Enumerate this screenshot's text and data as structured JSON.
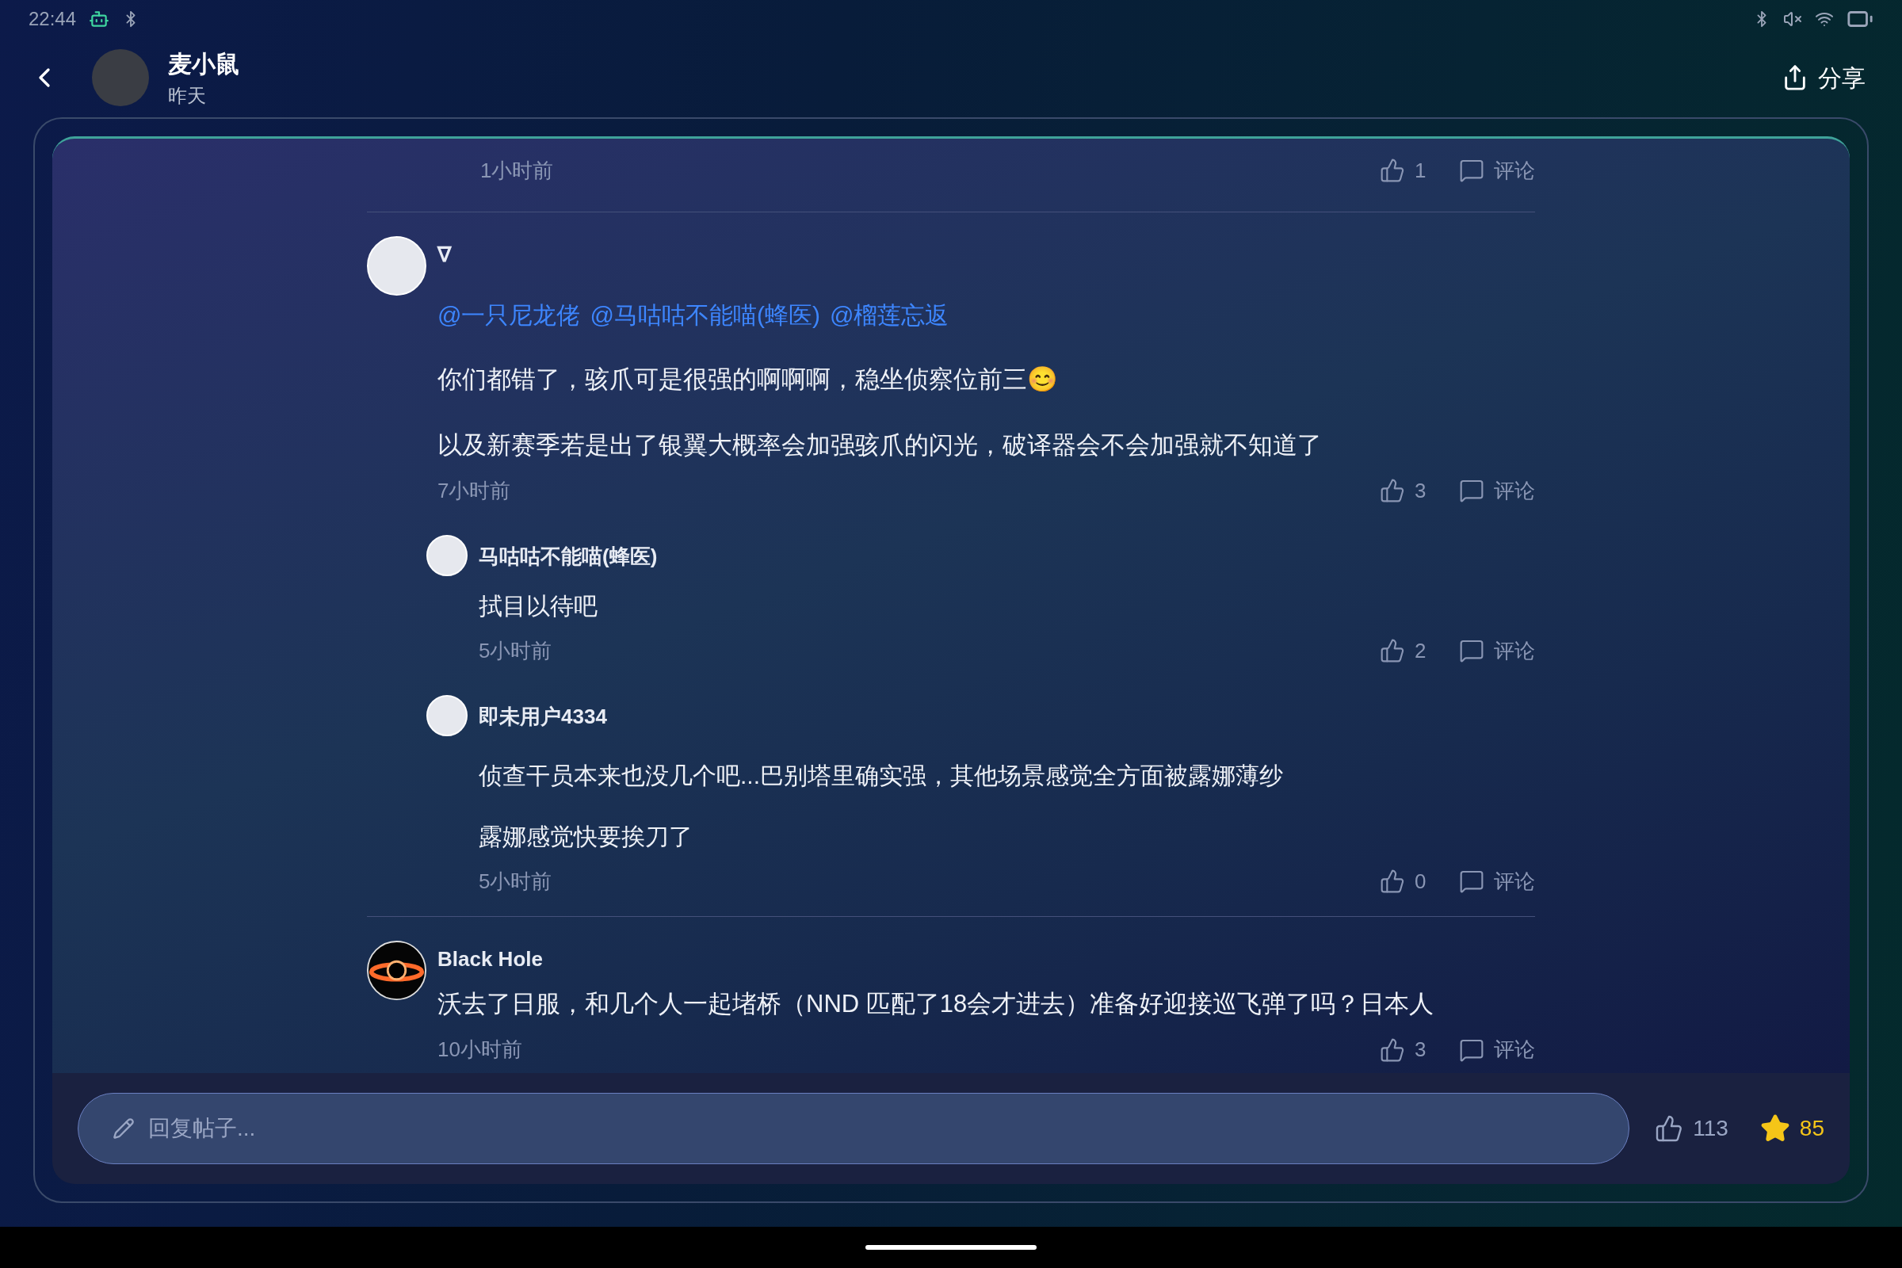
{
  "status_bar": {
    "time": "22:44"
  },
  "header": {
    "title": "麦小鼠",
    "subtitle": "昨天",
    "share": "分享"
  },
  "comments": [
    {
      "kind": "reply_tail",
      "time": "1小时前",
      "likes": "1",
      "reply_label": "评论"
    },
    {
      "kind": "comment",
      "author": "∇",
      "mentions": [
        "@一只尼龙佬",
        "@马咕咕不能喵(蜂医)",
        "@榴莲忘返"
      ],
      "paragraphs": [
        "你们都错了，骇爪可是很强的啊啊啊，稳坐侦察位前三😊",
        "以及新赛季若是出了银翼大概率会加强骇爪的闪光，破译器会不会加强就不知道了"
      ],
      "time": "7小时前",
      "likes": "3",
      "reply_label": "评论",
      "replies": [
        {
          "author": "马咕咕不能喵(蜂医)",
          "paragraphs": [
            "拭目以待吧"
          ],
          "time": "5小时前",
          "likes": "2",
          "reply_label": "评论"
        },
        {
          "author": "即未用户4334",
          "paragraphs": [
            "侦查干员本来也没几个吧...巴别塔里确实强，其他场景感觉全方面被露娜薄纱",
            "露娜感觉快要挨刀了"
          ],
          "time": "5小时前",
          "likes": "0",
          "reply_label": "评论"
        }
      ]
    },
    {
      "kind": "comment",
      "author": "Black Hole",
      "avatar": {
        "kind": "ringed_orb"
      },
      "paragraphs": [
        "沃去了日服，和几个人一起堵桥（NND 匹配了18会才进去）准备好迎接巡飞弹了吗？日本人"
      ],
      "time": "10小时前",
      "likes": "3",
      "reply_label": "评论"
    }
  ],
  "reply_bar": {
    "placeholder": "回复帖子...",
    "likes": "113",
    "favorites": "85"
  }
}
